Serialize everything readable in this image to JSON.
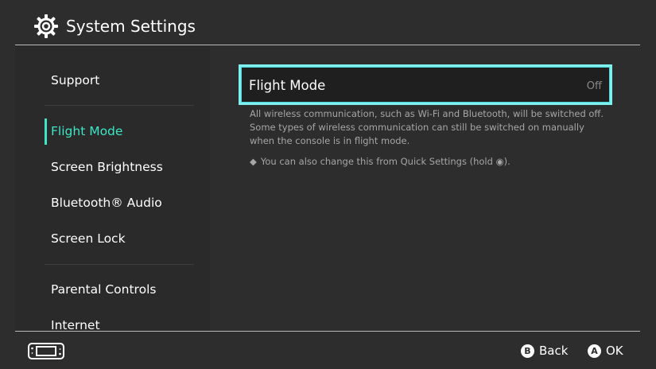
{
  "header": {
    "title": "System Settings",
    "icon": "gear-icon"
  },
  "sidebar": {
    "items": [
      {
        "label": "Support",
        "active": false
      },
      {
        "label": "Flight Mode",
        "active": true
      },
      {
        "label": "Screen Brightness",
        "active": false
      },
      {
        "label": "Bluetooth® Audio",
        "active": false
      },
      {
        "label": "Screen Lock",
        "active": false
      },
      {
        "label": "Parental Controls",
        "active": false
      },
      {
        "label": "Internet",
        "active": false
      }
    ]
  },
  "main": {
    "setting": {
      "label": "Flight Mode",
      "value": "Off"
    },
    "description": "All wireless communication, such as Wi-Fi and Bluetooth, will be switched off. Some types of wireless communication can still be switched on manually when the console is in flight mode.",
    "note": "You can also change this from Quick Settings (hold ◉).",
    "note_bullet": "◆"
  },
  "footer": {
    "back": {
      "button": "B",
      "label": "Back"
    },
    "ok": {
      "button": "A",
      "label": "OK"
    }
  },
  "colors": {
    "background": "#2d2d2d",
    "sidebar": "#2a2a2a",
    "accent": "#3ee6c6",
    "highlight_border": "#7ff0ee",
    "row_background": "#1f1f1f",
    "muted_text": "#a6a6a6"
  }
}
